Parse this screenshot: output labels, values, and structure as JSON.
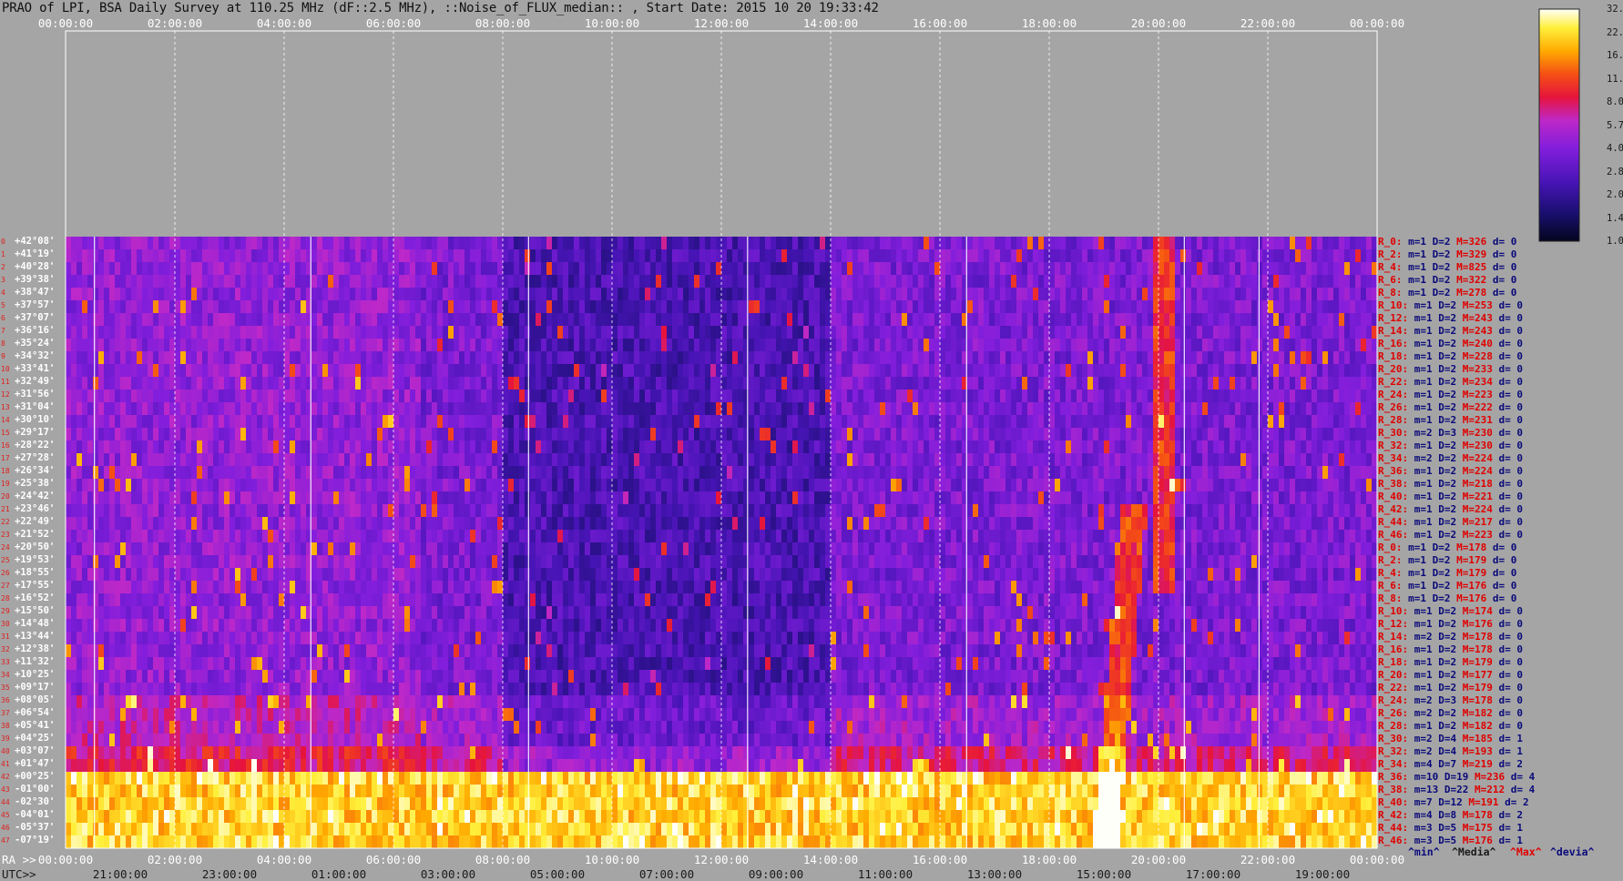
{
  "title": "PRAO of LPI, BSA Daily Survey at 110.25 MHz (dF::2.5 MHz), ::Noise_of_FLUX_median:: , Start Date: 2015 10 20 19:33:42",
  "top_ticks": [
    "00:00:00",
    "02:00:00",
    "04:00:00",
    "06:00:00",
    "08:00:00",
    "10:00:00",
    "12:00:00",
    "14:00:00",
    "16:00:00",
    "18:00:00",
    "20:00:00",
    "22:00:00",
    "00:00:00"
  ],
  "ra_label": "RA >>",
  "ra_ticks": [
    "00:00:00",
    "02:00:00",
    "04:00:00",
    "06:00:00",
    "08:00:00",
    "10:00:00",
    "12:00:00",
    "14:00:00",
    "16:00:00",
    "18:00:00",
    "20:00:00",
    "22:00:00",
    "00:00:00"
  ],
  "utc_label": "UTC>>",
  "utc_ticks": [
    "21:00:00",
    "23:00:00",
    "01:00:00",
    "03:00:00",
    "05:00:00",
    "07:00:00",
    "09:00:00",
    "11:00:00",
    "13:00:00",
    "15:00:00",
    "17:00:00",
    "19:00:00"
  ],
  "declinations": [
    "+42°08'",
    "+41°19'",
    "+40°28'",
    "+39°38'",
    "+38°47'",
    "+37°57'",
    "+37°07'",
    "+36°16'",
    "+35°24'",
    "+34°32'",
    "+33°41'",
    "+32°49'",
    "+31°56'",
    "+31°04'",
    "+30°10'",
    "+29°17'",
    "+28°22'",
    "+27°28'",
    "+26°34'",
    "+25°38'",
    "+24°42'",
    "+23°46'",
    "+22°49'",
    "+21°52'",
    "+20°50'",
    "+19°53'",
    "+18°55'",
    "+17°55'",
    "+16°52'",
    "+15°50'",
    "+14°48'",
    "+13°44'",
    "+12°38'",
    "+11°32'",
    "+10°25'",
    "+09°17'",
    "+08°05'",
    "+06°54'",
    "+05°41'",
    "+04°25'",
    "+03°07'",
    "+01°47'",
    "+00°25'",
    "-01°00'",
    "-02°30'",
    "-04°01'",
    "-05°37'",
    "-07°19'"
  ],
  "stats": [
    {
      "r": "R_0:",
      "m": "m=1",
      "d": "D=2",
      "x": "M=326",
      "e": "d= 0"
    },
    {
      "r": "R_2:",
      "m": "m=1",
      "d": "D=2",
      "x": "M=329",
      "e": "d= 0"
    },
    {
      "r": "R_4:",
      "m": "m=1",
      "d": "D=2",
      "x": "M=825",
      "e": "d= 0"
    },
    {
      "r": "R_6:",
      "m": "m=1",
      "d": "D=2",
      "x": "M=322",
      "e": "d= 0"
    },
    {
      "r": "R_8:",
      "m": "m=1",
      "d": "D=2",
      "x": "M=278",
      "e": "d= 0"
    },
    {
      "r": "R_10:",
      "m": "m=1",
      "d": "D=2",
      "x": "M=253",
      "e": "d= 0"
    },
    {
      "r": "R_12:",
      "m": "m=1",
      "d": "D=2",
      "x": "M=243",
      "e": "d= 0"
    },
    {
      "r": "R_14:",
      "m": "m=1",
      "d": "D=2",
      "x": "M=243",
      "e": "d= 0"
    },
    {
      "r": "R_16:",
      "m": "m=1",
      "d": "D=2",
      "x": "M=240",
      "e": "d= 0"
    },
    {
      "r": "R_18:",
      "m": "m=1",
      "d": "D=2",
      "x": "M=228",
      "e": "d= 0"
    },
    {
      "r": "R_20:",
      "m": "m=1",
      "d": "D=2",
      "x": "M=233",
      "e": "d= 0"
    },
    {
      "r": "R_22:",
      "m": "m=1",
      "d": "D=2",
      "x": "M=234",
      "e": "d= 0"
    },
    {
      "r": "R_24:",
      "m": "m=1",
      "d": "D=2",
      "x": "M=223",
      "e": "d= 0"
    },
    {
      "r": "R_26:",
      "m": "m=1",
      "d": "D=2",
      "x": "M=222",
      "e": "d= 0"
    },
    {
      "r": "R_28:",
      "m": "m=1",
      "d": "D=2",
      "x": "M=231",
      "e": "d= 0"
    },
    {
      "r": "R_30:",
      "m": "m=2",
      "d": "D=3",
      "x": "M=230",
      "e": "d= 0"
    },
    {
      "r": "R_32:",
      "m": "m=1",
      "d": "D=2",
      "x": "M=230",
      "e": "d= 0"
    },
    {
      "r": "R_34:",
      "m": "m=2",
      "d": "D=2",
      "x": "M=224",
      "e": "d= 0"
    },
    {
      "r": "R_36:",
      "m": "m=1",
      "d": "D=2",
      "x": "M=224",
      "e": "d= 0"
    },
    {
      "r": "R_38:",
      "m": "m=1",
      "d": "D=2",
      "x": "M=218",
      "e": "d= 0"
    },
    {
      "r": "R_40:",
      "m": "m=1",
      "d": "D=2",
      "x": "M=221",
      "e": "d= 0"
    },
    {
      "r": "R_42:",
      "m": "m=1",
      "d": "D=2",
      "x": "M=224",
      "e": "d= 0"
    },
    {
      "r": "R_44:",
      "m": "m=1",
      "d": "D=2",
      "x": "M=217",
      "e": "d= 0"
    },
    {
      "r": "R_46:",
      "m": "m=1",
      "d": "D=2",
      "x": "M=223",
      "e": "d= 0"
    },
    {
      "r": "R_0:",
      "m": "m=1",
      "d": "D=2",
      "x": "M=178",
      "e": "d= 0"
    },
    {
      "r": "R_2:",
      "m": "m=1",
      "d": "D=2",
      "x": "M=179",
      "e": "d= 0"
    },
    {
      "r": "R_4:",
      "m": "m=1",
      "d": "D=2",
      "x": "M=179",
      "e": "d= 0"
    },
    {
      "r": "R_6:",
      "m": "m=1",
      "d": "D=2",
      "x": "M=176",
      "e": "d= 0"
    },
    {
      "r": "R_8:",
      "m": "m=1",
      "d": "D=2",
      "x": "M=176",
      "e": "d= 0"
    },
    {
      "r": "R_10:",
      "m": "m=1",
      "d": "D=2",
      "x": "M=174",
      "e": "d= 0"
    },
    {
      "r": "R_12:",
      "m": "m=1",
      "d": "D=2",
      "x": "M=176",
      "e": "d= 0"
    },
    {
      "r": "R_14:",
      "m": "m=2",
      "d": "D=2",
      "x": "M=178",
      "e": "d= 0"
    },
    {
      "r": "R_16:",
      "m": "m=1",
      "d": "D=2",
      "x": "M=178",
      "e": "d= 0"
    },
    {
      "r": "R_18:",
      "m": "m=1",
      "d": "D=2",
      "x": "M=179",
      "e": "d= 0"
    },
    {
      "r": "R_20:",
      "m": "m=1",
      "d": "D=2",
      "x": "M=177",
      "e": "d= 0"
    },
    {
      "r": "R_22:",
      "m": "m=1",
      "d": "D=2",
      "x": "M=179",
      "e": "d= 0"
    },
    {
      "r": "R_24:",
      "m": "m=2",
      "d": "D=3",
      "x": "M=178",
      "e": "d= 0"
    },
    {
      "r": "R_26:",
      "m": "m=2",
      "d": "D=2",
      "x": "M=182",
      "e": "d= 0"
    },
    {
      "r": "R_28:",
      "m": "m=1",
      "d": "D=2",
      "x": "M=182",
      "e": "d= 0"
    },
    {
      "r": "R_30:",
      "m": "m=2",
      "d": "D=4",
      "x": "M=185",
      "e": "d= 1"
    },
    {
      "r": "R_32:",
      "m": "m=2",
      "d": "D=4",
      "x": "M=193",
      "e": "d= 1"
    },
    {
      "r": "R_34:",
      "m": "m=4",
      "d": "D=7",
      "x": "M=219",
      "e": "d= 2"
    },
    {
      "r": "R_36:",
      "m": "m=10",
      "d": "D=19",
      "x": "M=236",
      "e": "d= 4"
    },
    {
      "r": "R_38:",
      "m": "m=13",
      "d": "D=22",
      "x": "M=212",
      "e": "d= 4"
    },
    {
      "r": "R_40:",
      "m": "m=7",
      "d": "D=12",
      "x": "M=191",
      "e": "d= 2"
    },
    {
      "r": "R_42:",
      "m": "m=4",
      "d": "D=8",
      "x": "M=178",
      "e": "d= 2"
    },
    {
      "r": "R_44:",
      "m": "m=3",
      "d": "D=5",
      "x": "M=175",
      "e": "d= 1"
    },
    {
      "r": "R_46:",
      "m": "m=3",
      "d": "D=5",
      "x": "M=176",
      "e": "d= 1"
    }
  ],
  "legend": {
    "min": "^min^",
    "median": "^Media^",
    "max": "^Max^",
    "dev": "^devia^"
  },
  "colorbar": {
    "ticks": [
      "32.0",
      "22.6",
      "16.0",
      "11.3",
      "8.0",
      "5.7",
      "4.0",
      "2.8",
      "2.0",
      "1.4",
      "1.0"
    ]
  },
  "colors": {
    "background": "#a5a5a5",
    "max_label": "#e00000",
    "stat_label": "#0a0a7a"
  },
  "chart_data": {
    "type": "heatmap",
    "title": "PRAO of LPI, BSA Daily Survey at 110.25 MHz (dF::2.5 MHz), ::Noise_of_FLUX_median:: , Start Date: 2015 10 20 19:33:42",
    "xlabel": "RA >> / UTC>>",
    "x_range": [
      "00:00:00",
      "24:00:00"
    ],
    "y_rows": 48,
    "y_range": [
      "+42°08'",
      "-07°19'"
    ],
    "scale": "log2",
    "z_range": [
      1.0,
      32.0
    ]
  }
}
